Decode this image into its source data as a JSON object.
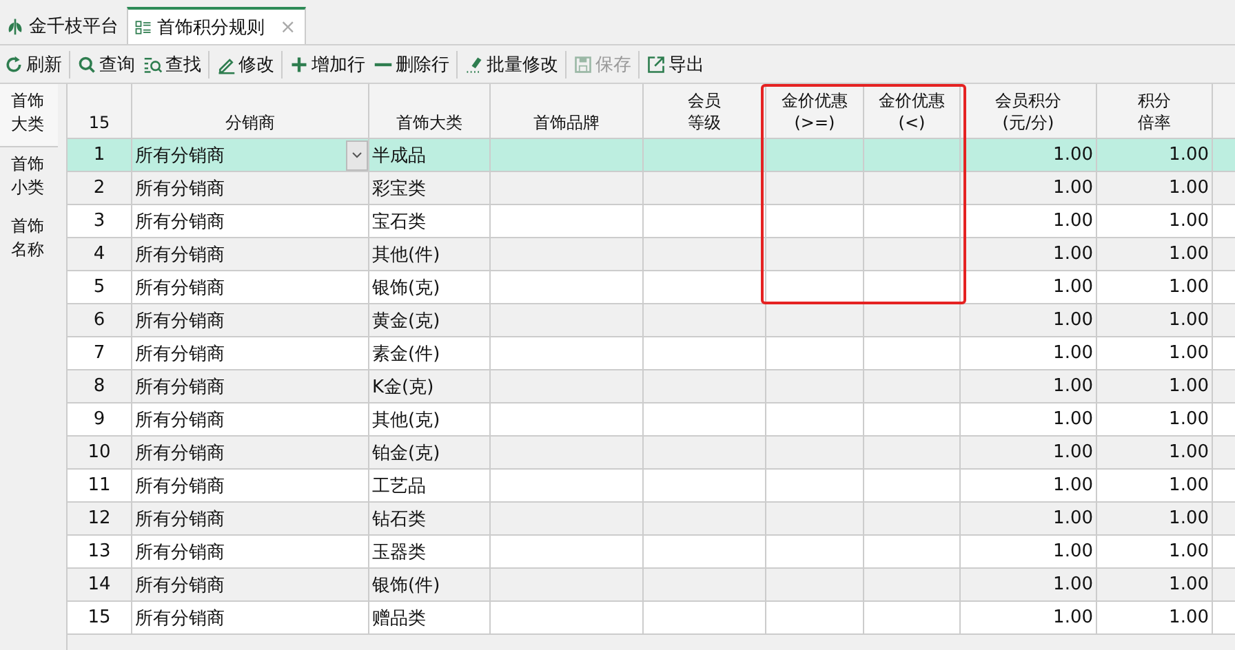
{
  "tabs": [
    {
      "label": "金千枝平台",
      "selected": false
    },
    {
      "label": "首饰积分规则",
      "selected": true,
      "close": "×"
    }
  ],
  "toolbar": [
    {
      "label": "刷新",
      "disabled": false
    },
    {
      "label": "查询",
      "disabled": false
    },
    {
      "label": "查找",
      "disabled": false
    },
    {
      "label": "修改",
      "disabled": false
    },
    {
      "label": "增加行",
      "disabled": false
    },
    {
      "label": "删除行",
      "disabled": false
    },
    {
      "label": "批量修改",
      "disabled": false
    },
    {
      "label": "保存",
      "disabled": true
    },
    {
      "label": "导出",
      "disabled": false
    }
  ],
  "sidebar": {
    "items": [
      {
        "label": "首饰大类",
        "selected": true
      },
      {
        "label": "首饰小类",
        "selected": false
      },
      {
        "label": "首饰名称",
        "selected": false
      }
    ]
  },
  "table": {
    "row_count": "15",
    "columns": [
      {
        "lines": [
          "分销商"
        ]
      },
      {
        "lines": [
          "首饰大类"
        ]
      },
      {
        "lines": [
          "首饰品牌"
        ]
      },
      {
        "lines": [
          "会员",
          "等级"
        ]
      },
      {
        "lines": [
          "金价优惠",
          "(>=)"
        ]
      },
      {
        "lines": [
          "金价优惠",
          "(<)"
        ]
      },
      {
        "lines": [
          "会员积分",
          "(元/分)"
        ]
      },
      {
        "lines": [
          "积分",
          "倍率"
        ]
      }
    ],
    "rows": [
      {
        "number": "1",
        "distributor": "所有分销商",
        "category": "半成品",
        "points": "1.00",
        "multiplier": "1.00",
        "selected": true
      },
      {
        "number": "2",
        "distributor": "所有分销商",
        "category": "彩宝类",
        "points": "1.00",
        "multiplier": "1.00",
        "selected": false
      },
      {
        "number": "3",
        "distributor": "所有分销商",
        "category": "宝石类",
        "points": "1.00",
        "multiplier": "1.00",
        "selected": false
      },
      {
        "number": "4",
        "distributor": "所有分销商",
        "category": "其他(件)",
        "points": "1.00",
        "multiplier": "1.00",
        "selected": false
      },
      {
        "number": "5",
        "distributor": "所有分销商",
        "category": "银饰(克)",
        "points": "1.00",
        "multiplier": "1.00",
        "selected": false
      },
      {
        "number": "6",
        "distributor": "所有分销商",
        "category": "黄金(克)",
        "points": "1.00",
        "multiplier": "1.00",
        "selected": false
      },
      {
        "number": "7",
        "distributor": "所有分销商",
        "category": "素金(件)",
        "points": "1.00",
        "multiplier": "1.00",
        "selected": false
      },
      {
        "number": "8",
        "distributor": "所有分销商",
        "category": "K金(克)",
        "points": "1.00",
        "multiplier": "1.00",
        "selected": false
      },
      {
        "number": "9",
        "distributor": "所有分销商",
        "category": "其他(克)",
        "points": "1.00",
        "multiplier": "1.00",
        "selected": false
      },
      {
        "number": "10",
        "distributor": "所有分销商",
        "category": "铂金(克)",
        "points": "1.00",
        "multiplier": "1.00",
        "selected": false
      },
      {
        "number": "11",
        "distributor": "所有分销商",
        "category": "工艺品",
        "points": "1.00",
        "multiplier": "1.00",
        "selected": false
      },
      {
        "number": "12",
        "distributor": "所有分销商",
        "category": "钻石类",
        "points": "1.00",
        "multiplier": "1.00",
        "selected": false
      },
      {
        "number": "13",
        "distributor": "所有分销商",
        "category": "玉器类",
        "points": "1.00",
        "multiplier": "1.00",
        "selected": false
      },
      {
        "number": "14",
        "distributor": "所有分销商",
        "category": "银饰(件)",
        "points": "1.00",
        "multiplier": "1.00",
        "selected": false
      },
      {
        "number": "15",
        "distributor": "所有分销商",
        "category": "赠品类",
        "points": "1.00",
        "multiplier": "1.00",
        "selected": false
      }
    ]
  }
}
